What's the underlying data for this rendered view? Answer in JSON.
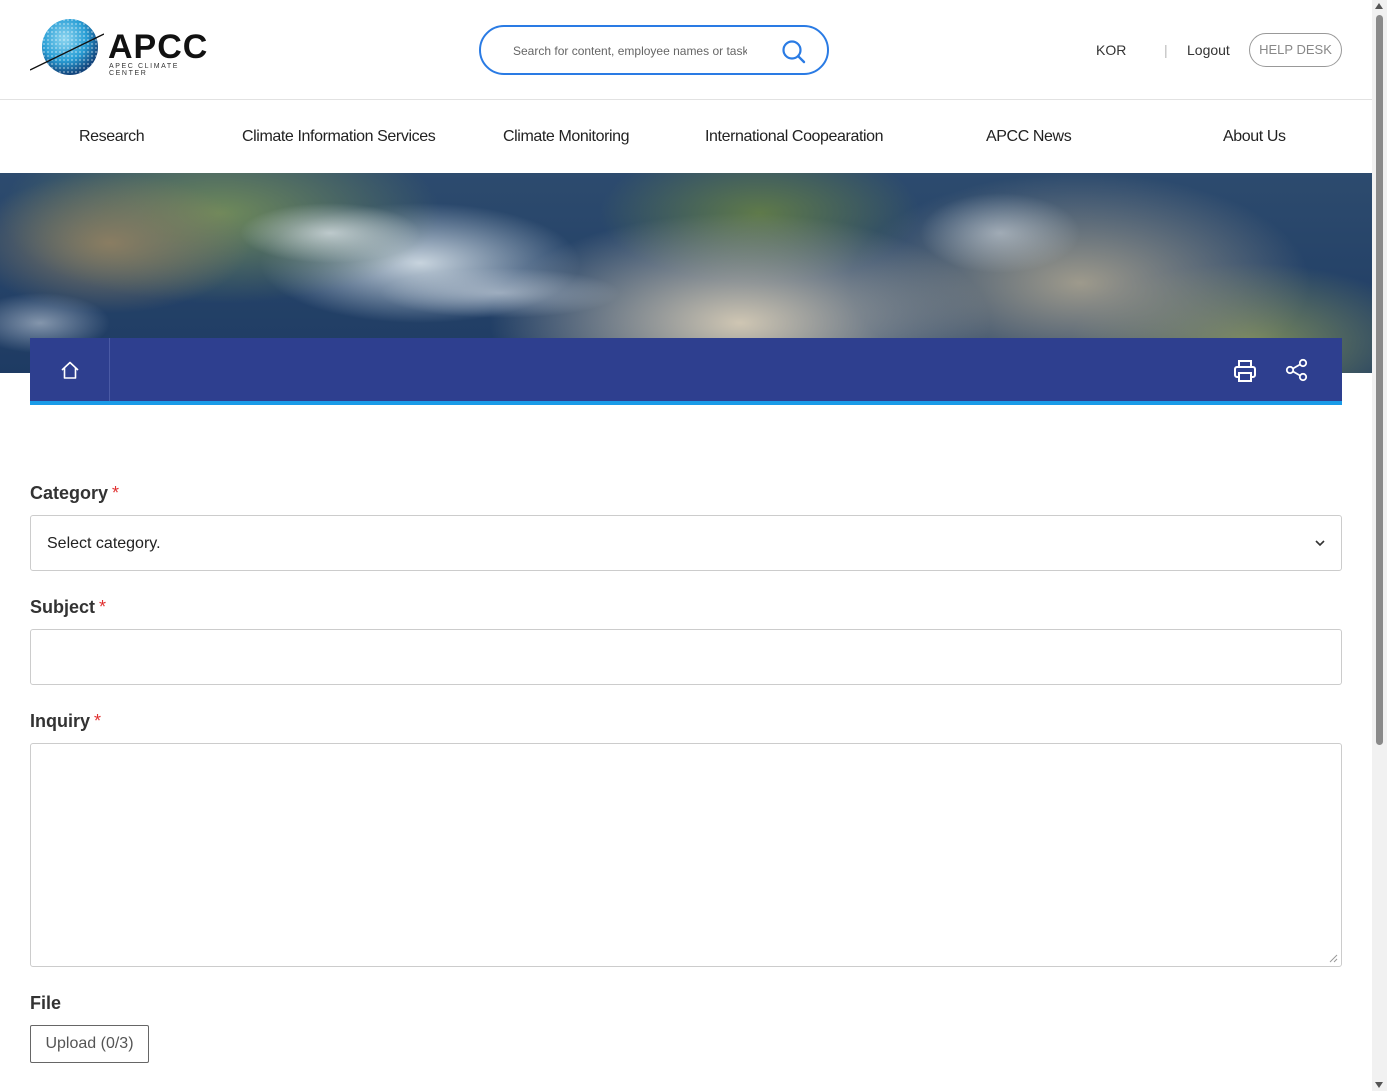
{
  "header": {
    "logo_text": "APCC",
    "logo_subtext": "APEC CLIMATE CENTER",
    "search_placeholder": "Search for content, employee names or tasks",
    "lang": "KOR",
    "separator": "|",
    "logout": "Logout",
    "helpdesk": "HELP DESK"
  },
  "nav": {
    "items": [
      {
        "label": "Research"
      },
      {
        "label": "Climate Information Services"
      },
      {
        "label": "Climate Monitoring"
      },
      {
        "label": "International Coopearation"
      },
      {
        "label": "APCC News"
      },
      {
        "label": "About Us"
      }
    ]
  },
  "location_bar": {
    "icons": [
      "home-icon",
      "print-icon",
      "share-icon"
    ]
  },
  "form": {
    "category": {
      "label": "Category",
      "required_mark": "*",
      "selected": "Select category."
    },
    "subject": {
      "label": "Subject",
      "required_mark": "*",
      "value": ""
    },
    "inquiry": {
      "label": "Inquiry",
      "required_mark": "*",
      "value": ""
    },
    "file": {
      "label": "File",
      "upload_button": "Upload (0/3)"
    }
  },
  "colors": {
    "accent": "#2a7be4",
    "location_bar": "#2e3f8f",
    "location_bar_underline": "#1a9be8",
    "required": "#e03030"
  }
}
